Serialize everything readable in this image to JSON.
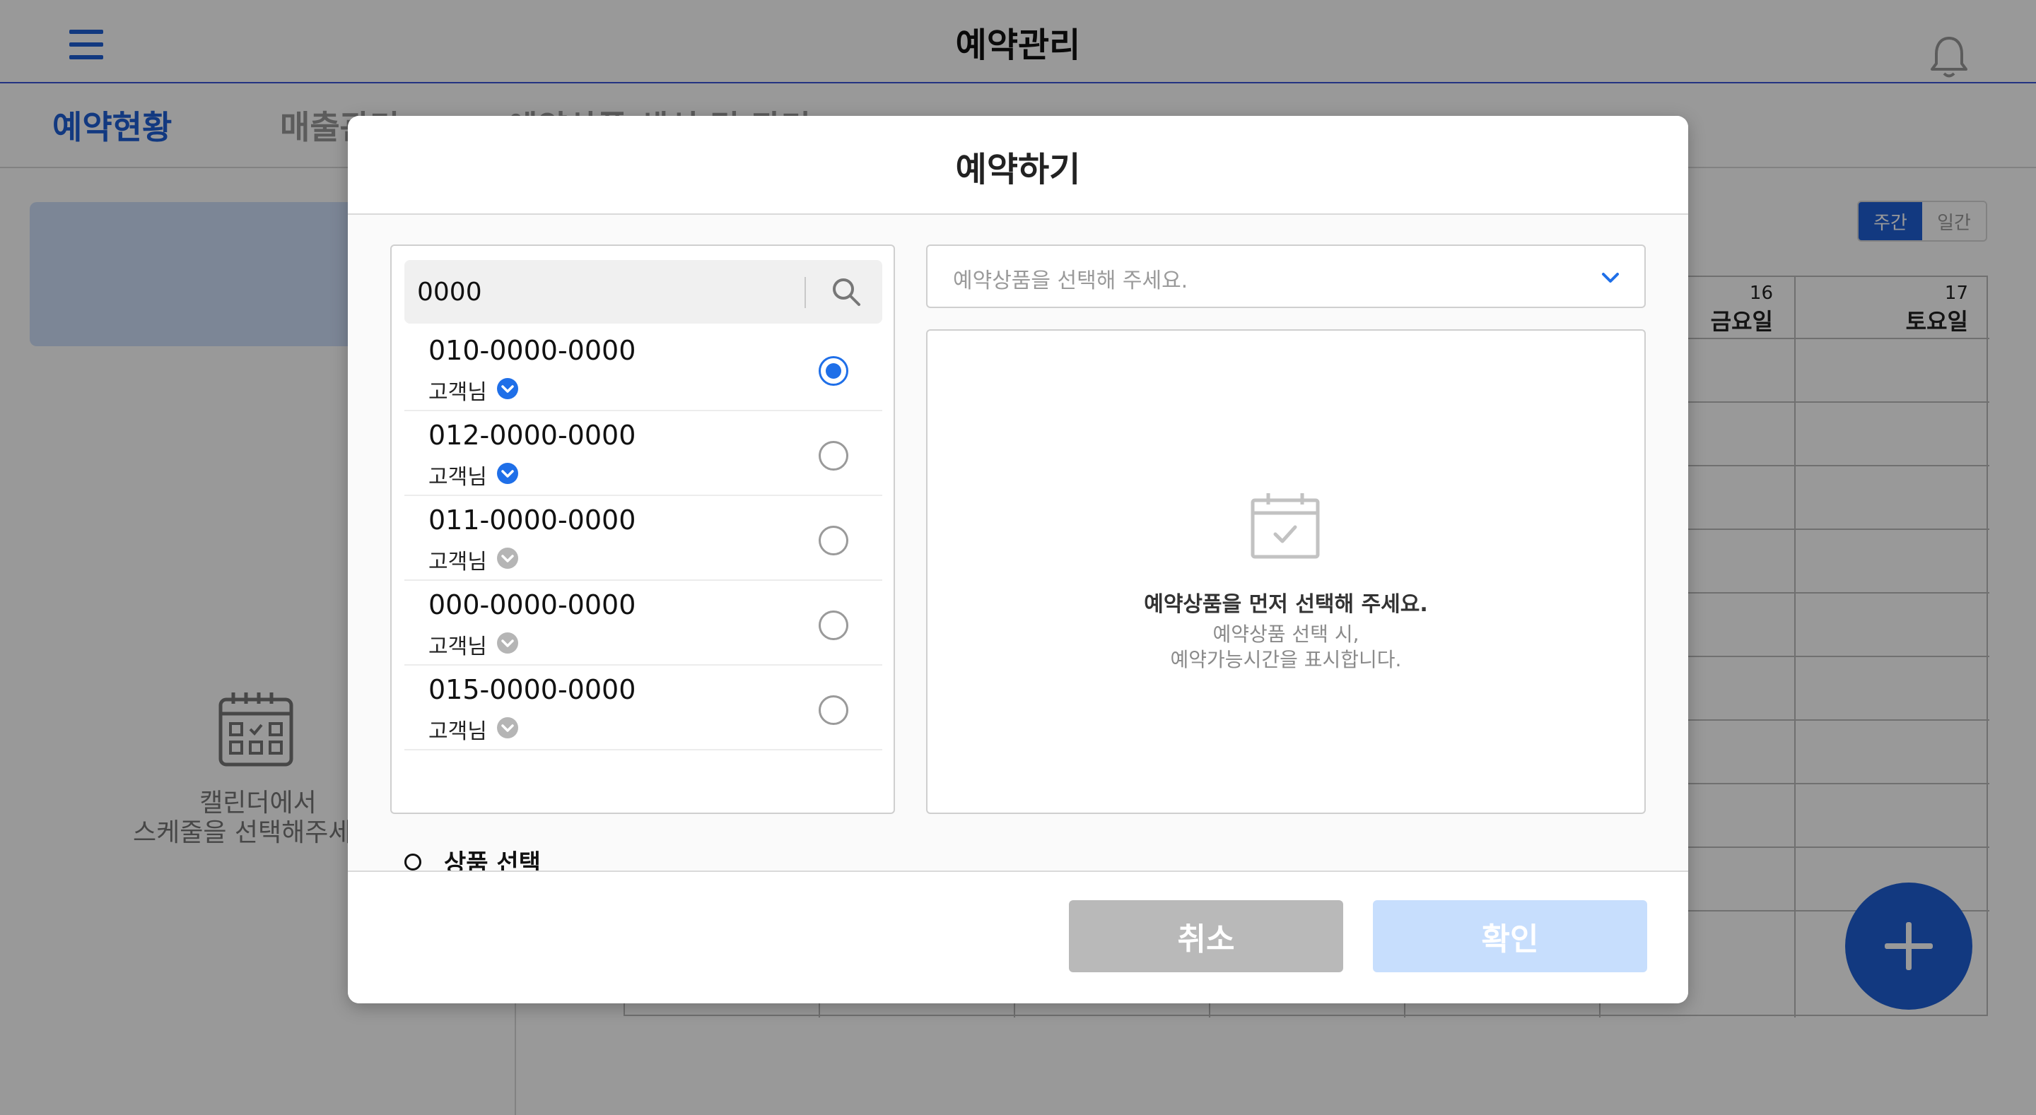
{
  "app": {
    "title": "예약관리",
    "tabs": [
      {
        "label": "예약현황",
        "active": true
      },
      {
        "label": "매출관리",
        "active": false
      },
      {
        "label": "예약상품 생성 및 관리",
        "active": false
      }
    ],
    "empty_calendar_text": "캘린더에서\n스케줄을 선택해주세요.",
    "view_toggle": {
      "weekly": "주간",
      "daily": "일간"
    },
    "calendar_days": [
      {
        "num": "16",
        "name": "금요일"
      },
      {
        "num": "17",
        "name": "토요일"
      }
    ],
    "accent_color": "#1f5fd6"
  },
  "modal": {
    "title": "예약하기",
    "search": {
      "value": "0000"
    },
    "customers": [
      {
        "phone": "010-0000-0000",
        "label": "고객님",
        "verified": true,
        "selected": true
      },
      {
        "phone": "012-0000-0000",
        "label": "고객님",
        "verified": true,
        "selected": false
      },
      {
        "phone": "011-0000-0000",
        "label": "고객님",
        "verified": false,
        "selected": false
      },
      {
        "phone": "000-0000-0000",
        "label": "고객님",
        "verified": false,
        "selected": false
      },
      {
        "phone": "015-0000-0000",
        "label": "고객님",
        "verified": false,
        "selected": false
      }
    ],
    "product_select": {
      "placeholder": "예약상품을 선택해 주세요."
    },
    "timeslot_empty": {
      "title": "예약상품을 먼저 선택해 주세요.",
      "subtitle": "예약상품 선택 시,\n예약가능시간을 표시합니다."
    },
    "section_label": "상품 선택",
    "buttons": {
      "cancel": "취소",
      "confirm": "확인"
    }
  }
}
